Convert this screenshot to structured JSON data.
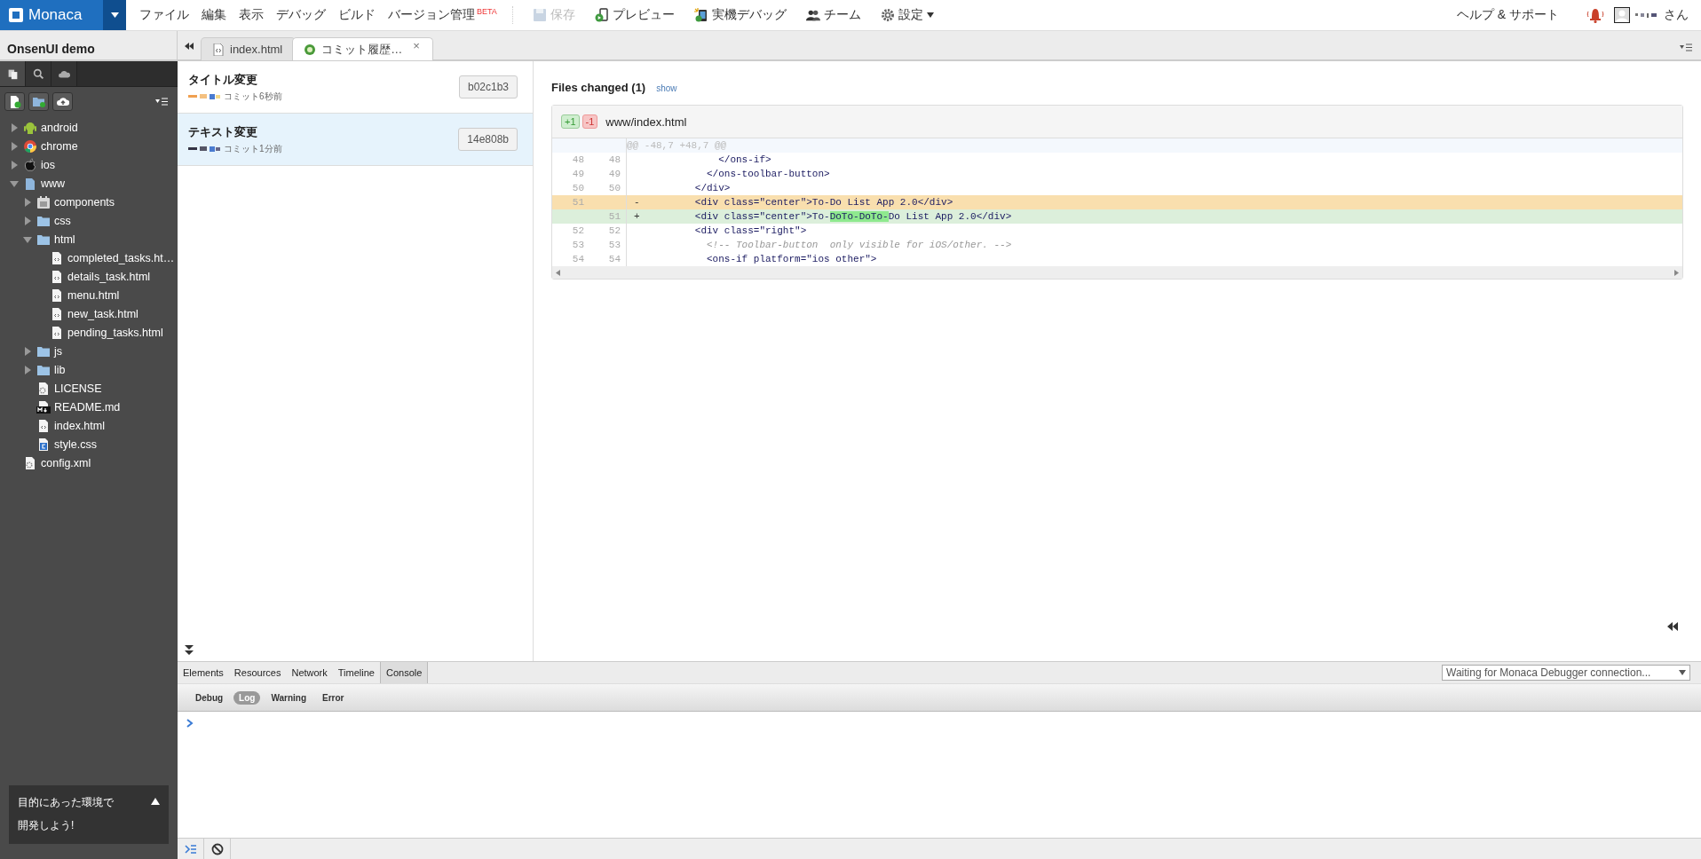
{
  "menu_bar": {
    "logo": "Monaca",
    "menus": [
      {
        "label": "ファイル"
      },
      {
        "label": "編集"
      },
      {
        "label": "表示"
      },
      {
        "label": "デバッグ"
      },
      {
        "label": "ビルド"
      },
      {
        "label": "バージョン管理",
        "badge": "BETA"
      }
    ],
    "tools": [
      {
        "label": "保存",
        "kind": "save",
        "disabled": true
      },
      {
        "label": "プレビュー",
        "kind": "preview",
        "disabled": false
      },
      {
        "label": "実機デバッグ",
        "kind": "device",
        "disabled": false
      },
      {
        "label": "チーム",
        "kind": "team",
        "disabled": false
      },
      {
        "label": "設定",
        "kind": "settings",
        "disabled": false
      }
    ],
    "help": "ヘルプ & サポート",
    "user_suffix": "さん"
  },
  "project": {
    "name": "OnsenUI demo"
  },
  "sidebar_tabs": [
    {
      "kind": "files",
      "selected": true
    },
    {
      "kind": "search",
      "selected": false
    },
    {
      "kind": "cloud",
      "selected": false
    }
  ],
  "tree": [
    {
      "label": "android",
      "kind": "android",
      "expanded": false
    },
    {
      "label": "chrome",
      "kind": "chrome",
      "expanded": false
    },
    {
      "label": "ios",
      "kind": "apple",
      "expanded": false
    },
    {
      "label": "www",
      "kind": "file-folder",
      "expanded": true,
      "children": [
        {
          "label": "components",
          "kind": "js-folder",
          "expanded": false
        },
        {
          "label": "css",
          "kind": "folder",
          "expanded": false
        },
        {
          "label": "html",
          "kind": "folder",
          "expanded": true,
          "children": [
            {
              "label": "completed_tasks.ht…",
              "kind": "html"
            },
            {
              "label": "details_task.html",
              "kind": "html"
            },
            {
              "label": "menu.html",
              "kind": "html"
            },
            {
              "label": "new_task.html",
              "kind": "html"
            },
            {
              "label": "pending_tasks.html",
              "kind": "html"
            }
          ]
        },
        {
          "label": "js",
          "kind": "folder",
          "expanded": false
        },
        {
          "label": "lib",
          "kind": "folder",
          "expanded": false
        },
        {
          "label": "LICENSE",
          "kind": "config"
        },
        {
          "label": "README.md",
          "kind": "markdown"
        },
        {
          "label": "index.html",
          "kind": "html"
        },
        {
          "label": "style.css",
          "kind": "css"
        }
      ]
    },
    {
      "label": "config.xml",
      "kind": "config"
    }
  ],
  "promo": {
    "lines": [
      "目的にあった環境で",
      "開発しよう!"
    ]
  },
  "editor_tabs": [
    {
      "label": "index.html",
      "kind": "html",
      "selected": false
    },
    {
      "label": "コミット履歴…",
      "kind": "history",
      "selected": true,
      "close": "×"
    }
  ],
  "commits": [
    {
      "title": "タイトル変更",
      "meta": "コミット6秒前",
      "hash": "b02c1b3",
      "selected": false
    },
    {
      "title": "テキスト変更",
      "meta": "コミット1分前",
      "hash": "14e808b",
      "selected": true
    }
  ],
  "diff": {
    "heading": "Files changed (1)",
    "toggle": "show",
    "additions": "+1",
    "deletions": "-1",
    "file": "www/index.html",
    "hunk": "@@ -48,7 +48,7 @@",
    "lines": [
      {
        "kind": "context",
        "old": "48",
        "new": "48",
        "parts": [
          {
            "text": "            </ons-if>",
            "highlight": false
          }
        ]
      },
      {
        "kind": "context",
        "old": "49",
        "new": "49",
        "parts": [
          {
            "text": "          </ons-toolbar-button>",
            "highlight": false
          }
        ]
      },
      {
        "kind": "context",
        "old": "50",
        "new": "50",
        "parts": [
          {
            "text": "        </div>",
            "highlight": false
          }
        ]
      },
      {
        "kind": "removed",
        "old": "51",
        "sign": "-",
        "parts": [
          {
            "text": "        <div class=\"center\">To-Do List App 2.0</div>",
            "highlight": false
          }
        ]
      },
      {
        "kind": "added",
        "new": "51",
        "sign": "+",
        "parts": [
          {
            "text": "        <div class=\"center\">To-",
            "highlight": false
          },
          {
            "text": "DoTo-DoTo-",
            "highlight": true
          },
          {
            "text": "Do List App 2.0</div>",
            "highlight": false
          }
        ]
      },
      {
        "kind": "context",
        "old": "52",
        "new": "52",
        "parts": [
          {
            "text": "        <div class=\"right\">",
            "highlight": false
          }
        ]
      },
      {
        "kind": "comment",
        "old": "53",
        "new": "53",
        "parts": [
          {
            "text": "          <!-- Toolbar-button  only visible for iOS/other. -->",
            "highlight": false
          }
        ]
      },
      {
        "kind": "context",
        "old": "54",
        "new": "54",
        "parts": [
          {
            "text": "          <ons-if platform=\"ios other\">",
            "highlight": false
          }
        ]
      }
    ]
  },
  "console": {
    "tabs": [
      {
        "label": "Elements",
        "selected": false
      },
      {
        "label": "Resources",
        "selected": false
      },
      {
        "label": "Network",
        "selected": false
      },
      {
        "label": "Timeline",
        "selected": false
      },
      {
        "label": "Console",
        "selected": true
      }
    ],
    "levels": [
      {
        "label": "Debug",
        "selected": false
      },
      {
        "label": "Log",
        "selected": true
      },
      {
        "label": "Warning",
        "selected": false
      },
      {
        "label": "Error",
        "selected": false
      }
    ],
    "connection": "Waiting for Monaca Debugger connection..."
  }
}
